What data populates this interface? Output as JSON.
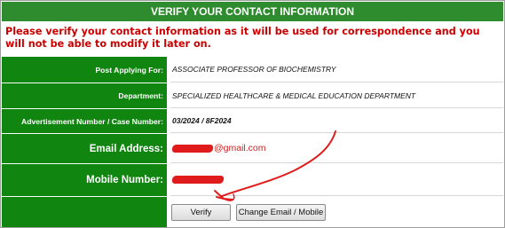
{
  "header": {
    "title": "VERIFY YOUR CONTACT INFORMATION"
  },
  "notice": {
    "text": "Please verify your contact information as it will be used for correspondence and you will not be able to modify it later on."
  },
  "fields": {
    "post": {
      "label": "Post Applying For:",
      "value": "ASSOCIATE PROFESSOR OF BIOCHEMISTRY"
    },
    "department": {
      "label": "Department:",
      "value": "SPECIALIZED HEALTHCARE & MEDICAL EDUCATION DEPARTMENT"
    },
    "advertisement": {
      "label": "Advertisement Number / Case Number:",
      "value": "03/2024 / 8F2024"
    },
    "email": {
      "label": "Email Address:",
      "value_visible": "@gmail.com"
    },
    "mobile": {
      "label": "Mobile Number:"
    }
  },
  "buttons": {
    "verify": "Verify",
    "change": "Change Email / Mobile"
  },
  "colors": {
    "header_green": "#2e8b2e",
    "label_green": "#108510",
    "notice_red": "#cc0000",
    "annotation_red": "#e01b1b"
  }
}
